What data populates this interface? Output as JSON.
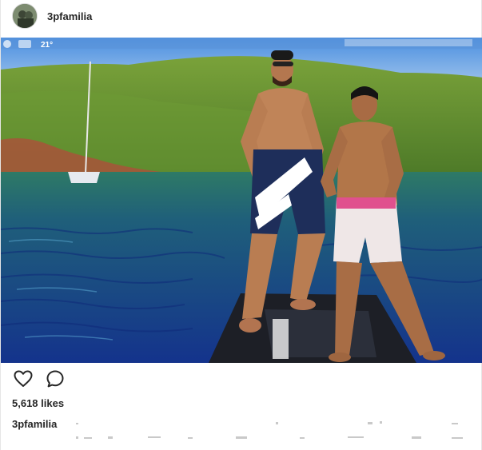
{
  "post": {
    "username": "3pfamilia",
    "likes_label": "5,618 likes",
    "caption_user": "3pfamilia",
    "caption_text": ""
  },
  "icons": {
    "like": "heart-outline-icon",
    "comment": "speech-bubble-icon"
  },
  "photo": {
    "status_temp": "21°"
  },
  "colors": {
    "text": "#262626",
    "border": "#dbdbdb",
    "sky": "#3b78c8",
    "hill": "#5b8a2e",
    "water": "#1a3f9a"
  }
}
